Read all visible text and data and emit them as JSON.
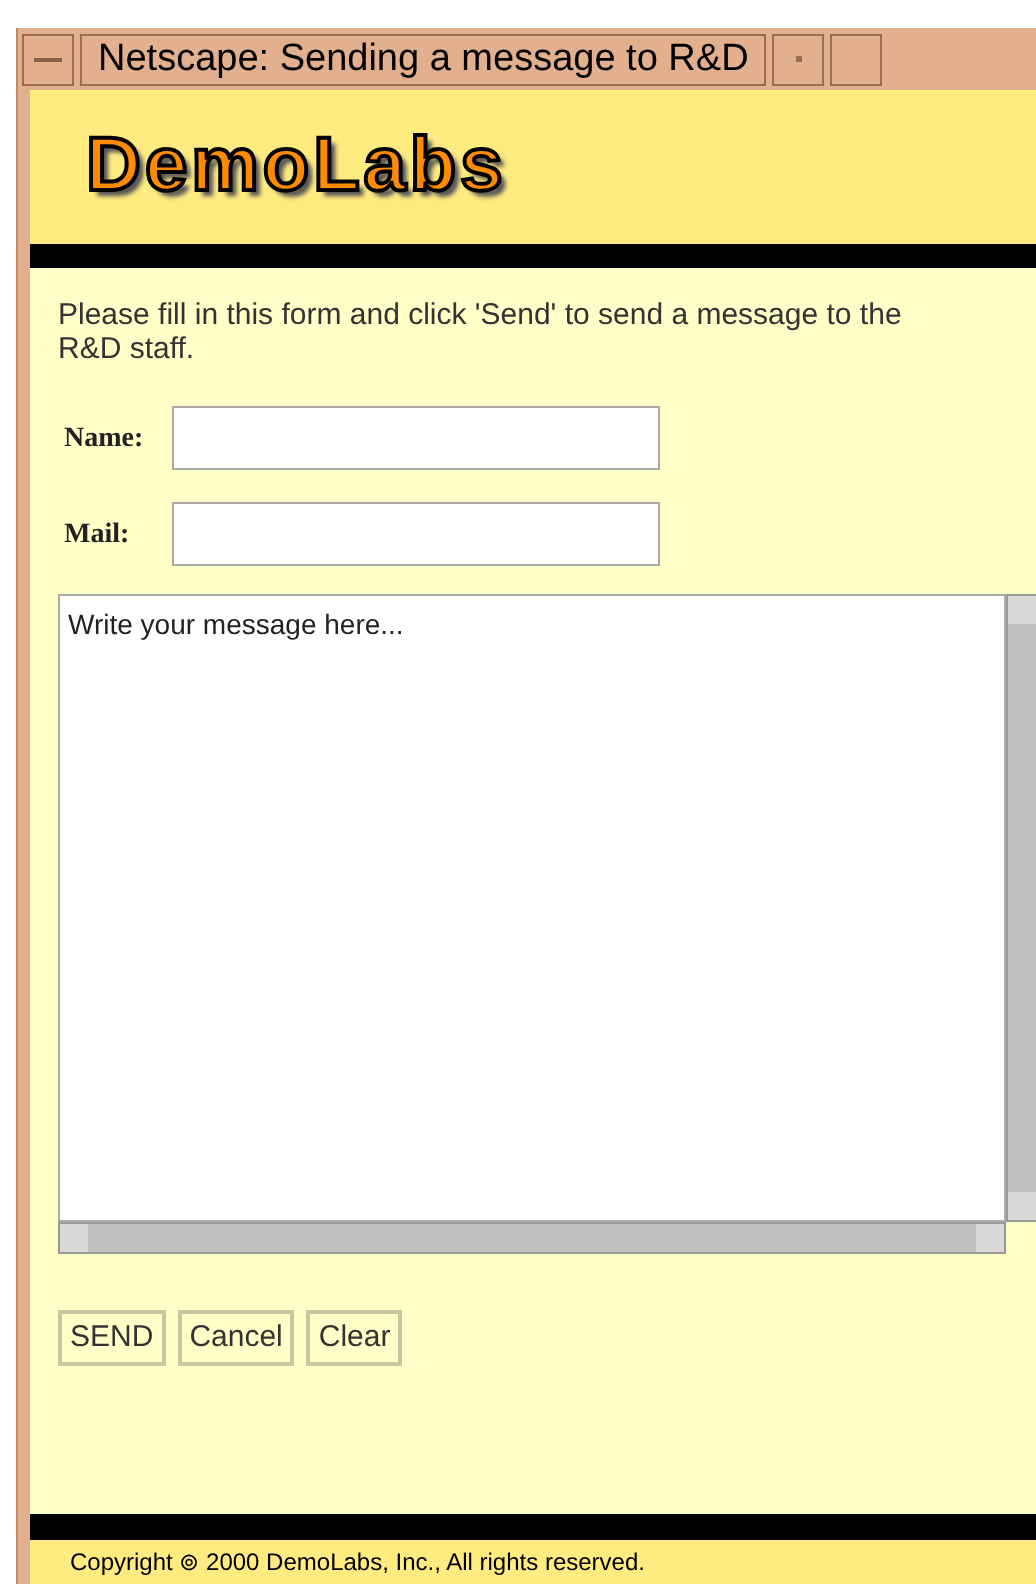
{
  "window": {
    "title": "Netscape: Sending a message to R&D"
  },
  "logo": {
    "text": "DemoLabs"
  },
  "intro": "Please fill in this form and click 'Send' to send a message to the R&D staff.",
  "fields": [
    {
      "label": "Name:"
    },
    {
      "label": "Mail:"
    }
  ],
  "message": {
    "placeholder": "Write your message here..."
  },
  "buttons": [
    "SEND",
    "Cancel",
    "Clear"
  ],
  "footer": "Copyright ⊚ 2000 DemoLabs, Inc., All rights reserved."
}
